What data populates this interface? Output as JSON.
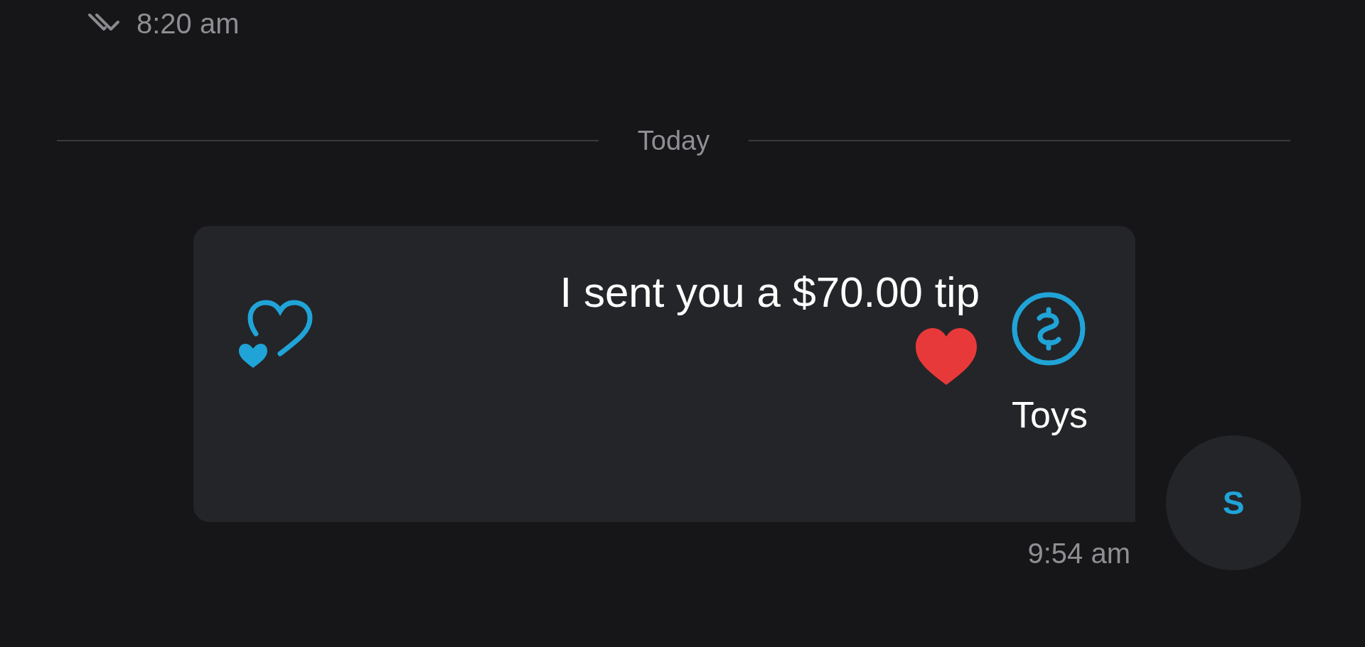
{
  "earlier_message": {
    "time": "8:20 am",
    "read": true
  },
  "date_divider": "Today",
  "message": {
    "avatar": "S",
    "tip_text": "I sent you a $70.00 tip",
    "text": "Toys",
    "time": "9:54 am",
    "liked": false
  }
}
